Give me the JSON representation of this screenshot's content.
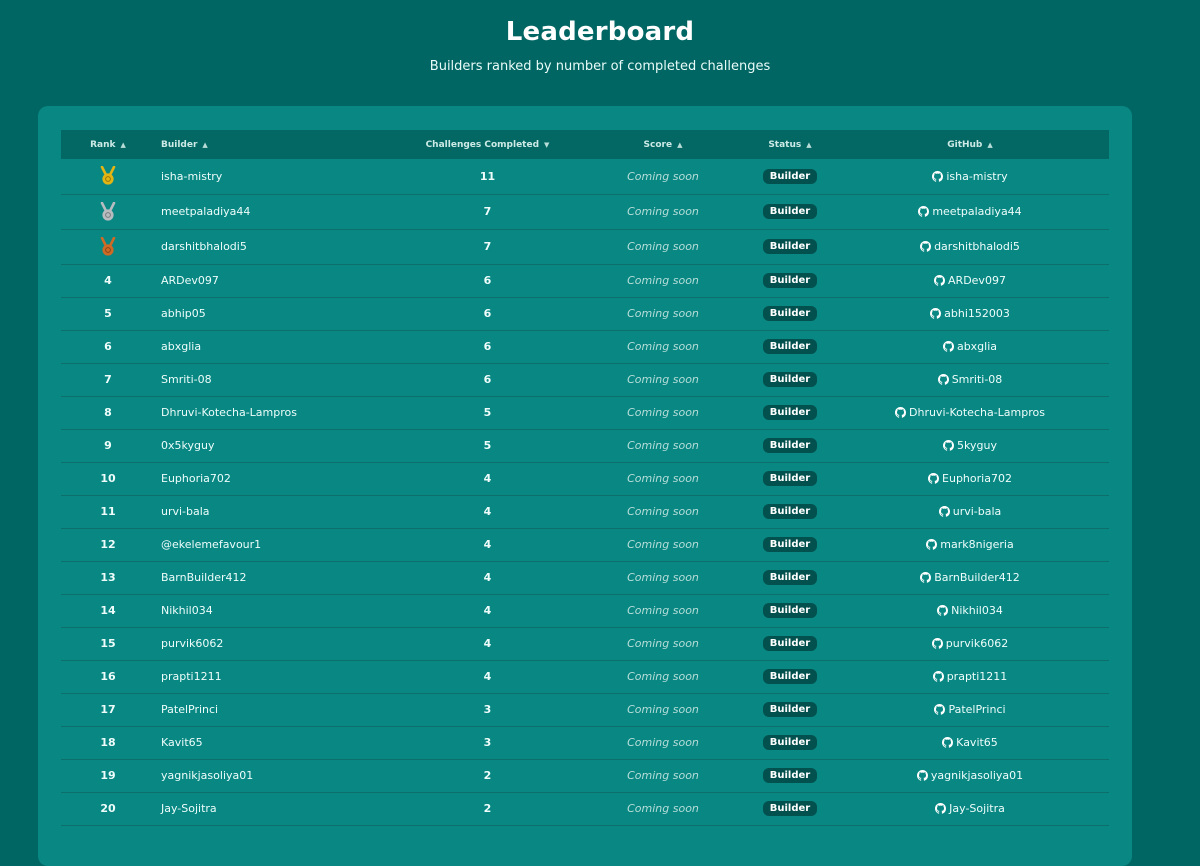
{
  "header": {
    "title": "Leaderboard",
    "subtitle": "Builders ranked by number of completed challenges"
  },
  "table": {
    "columns": [
      {
        "label": "Rank",
        "sort": "unsorted"
      },
      {
        "label": "Builder",
        "sort": "unsorted"
      },
      {
        "label": "Challenges Completed",
        "sort": "descending"
      },
      {
        "label": "Score",
        "sort": "unsorted"
      },
      {
        "label": "Status",
        "sort": "unsorted"
      },
      {
        "label": "GitHub",
        "sort": "unsorted"
      }
    ],
    "medal_colors": {
      "gold": "#e2b514",
      "silver": "#b6bcbf",
      "bronze": "#cd6b26"
    },
    "rows": [
      {
        "rank": "1",
        "medal": "gold",
        "builder": "isha-mistry",
        "completed": "11",
        "score": "Coming soon",
        "status": "Builder",
        "github": "isha-mistry"
      },
      {
        "rank": "2",
        "medal": "silver",
        "builder": "meetpaladiya44",
        "completed": "7",
        "score": "Coming soon",
        "status": "Builder",
        "github": "meetpaladiya44"
      },
      {
        "rank": "3",
        "medal": "bronze",
        "builder": "darshitbhalodi5",
        "completed": "7",
        "score": "Coming soon",
        "status": "Builder",
        "github": "darshitbhalodi5"
      },
      {
        "rank": "4",
        "builder": "ARDev097",
        "completed": "6",
        "score": "Coming soon",
        "status": "Builder",
        "github": "ARDev097"
      },
      {
        "rank": "5",
        "builder": "abhip05",
        "completed": "6",
        "score": "Coming soon",
        "status": "Builder",
        "github": "abhi152003"
      },
      {
        "rank": "6",
        "builder": "abxglia",
        "completed": "6",
        "score": "Coming soon",
        "status": "Builder",
        "github": "abxglia"
      },
      {
        "rank": "7",
        "builder": "Smriti-08",
        "completed": "6",
        "score": "Coming soon",
        "status": "Builder",
        "github": "Smriti-08"
      },
      {
        "rank": "8",
        "builder": "Dhruvi-Kotecha-Lampros",
        "completed": "5",
        "score": "Coming soon",
        "status": "Builder",
        "github": "Dhruvi-Kotecha-Lampros"
      },
      {
        "rank": "9",
        "builder": "0x5kyguy",
        "completed": "5",
        "score": "Coming soon",
        "status": "Builder",
        "github": "5kyguy"
      },
      {
        "rank": "10",
        "builder": "Euphoria702",
        "completed": "4",
        "score": "Coming soon",
        "status": "Builder",
        "github": "Euphoria702"
      },
      {
        "rank": "11",
        "builder": "urvi-bala",
        "completed": "4",
        "score": "Coming soon",
        "status": "Builder",
        "github": "urvi-bala"
      },
      {
        "rank": "12",
        "builder": "@ekelemefavour1",
        "completed": "4",
        "score": "Coming soon",
        "status": "Builder",
        "github": "mark8nigeria"
      },
      {
        "rank": "13",
        "builder": "BarnBuilder412",
        "completed": "4",
        "score": "Coming soon",
        "status": "Builder",
        "github": "BarnBuilder412"
      },
      {
        "rank": "14",
        "builder": "Nikhil034",
        "completed": "4",
        "score": "Coming soon",
        "status": "Builder",
        "github": "Nikhil034"
      },
      {
        "rank": "15",
        "builder": "purvik6062",
        "completed": "4",
        "score": "Coming soon",
        "status": "Builder",
        "github": "purvik6062"
      },
      {
        "rank": "16",
        "builder": "prapti1211",
        "completed": "4",
        "score": "Coming soon",
        "status": "Builder",
        "github": "prapti1211"
      },
      {
        "rank": "17",
        "builder": "PatelPrinci",
        "completed": "3",
        "score": "Coming soon",
        "status": "Builder",
        "github": "PatelPrinci"
      },
      {
        "rank": "18",
        "builder": "Kavit65",
        "completed": "3",
        "score": "Coming soon",
        "status": "Builder",
        "github": "Kavit65"
      },
      {
        "rank": "19",
        "builder": "yagnikjasoliya01",
        "completed": "2",
        "score": "Coming soon",
        "status": "Builder",
        "github": "yagnikjasoliya01"
      },
      {
        "rank": "20",
        "builder": "Jay-Sojitra",
        "completed": "2",
        "score": "Coming soon",
        "status": "Builder",
        "github": "Jay-Sojitra"
      }
    ]
  }
}
